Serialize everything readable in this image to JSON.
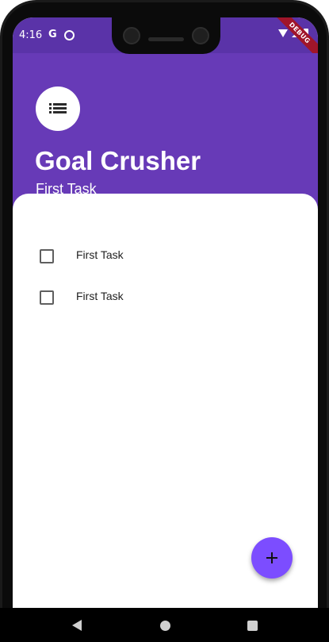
{
  "status_bar": {
    "time": "4:16",
    "google_glyph": "G",
    "debug_label": "DEBUG",
    "icons": [
      "g-icon",
      "sync-icon",
      "wifi-icon",
      "signal-icon",
      "battery-icon"
    ]
  },
  "header": {
    "menu_icon": "list-icon",
    "title": "Goal Crusher",
    "subtitle": "First Task",
    "background_color": "#673ab7",
    "status_bar_color": "#5a33a8"
  },
  "tasks": [
    {
      "label": "First Task",
      "checked": false
    },
    {
      "label": "First Task",
      "checked": false
    }
  ],
  "fab": {
    "icon": "add-icon",
    "color": "#7c4dff"
  },
  "nav_bar": {
    "buttons": [
      "back-icon",
      "home-icon",
      "recents-icon"
    ]
  }
}
